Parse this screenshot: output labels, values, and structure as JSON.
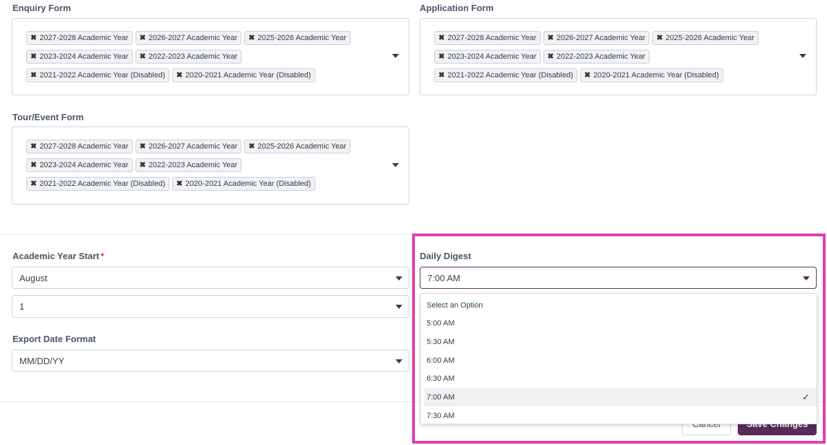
{
  "enquiry_form": {
    "label": "Enquiry Form",
    "tags": [
      "2027-2028 Academic Year",
      "2026-2027 Academic Year",
      "2025-2026 Academic Year",
      "2023-2024 Academic Year",
      "2022-2023 Academic Year",
      "2021-2022 Academic Year (Disabled)",
      "2020-2021 Academic Year (Disabled)"
    ]
  },
  "application_form": {
    "label": "Application Form",
    "tags": [
      "2027-2028 Academic Year",
      "2026-2027 Academic Year",
      "2025-2026 Academic Year",
      "2023-2024 Academic Year",
      "2022-2023 Academic Year",
      "2021-2022 Academic Year (Disabled)",
      "2020-2021 Academic Year (Disabled)"
    ]
  },
  "tour_event_form": {
    "label": "Tour/Event Form",
    "tags": [
      "2027-2028 Academic Year",
      "2026-2027 Academic Year",
      "2025-2026 Academic Year",
      "2023-2024 Academic Year",
      "2022-2023 Academic Year",
      "2021-2022 Academic Year (Disabled)",
      "2020-2021 Academic Year (Disabled)"
    ]
  },
  "tag_remove_glyph": "✖",
  "academic_year_start": {
    "label": "Academic Year Start",
    "required_mark": "*",
    "month_value": "August",
    "day_value": "1"
  },
  "export_date_format": {
    "label": "Export Date Format",
    "value": "MM/DD/YY"
  },
  "daily_digest": {
    "label": "Daily Digest",
    "value": "7:00 AM",
    "options": [
      "Select an Option",
      "5:00 AM",
      "5:30 AM",
      "6:00 AM",
      "6:30 AM",
      "7:00 AM",
      "7:30 AM"
    ],
    "selected_index": 5,
    "check_glyph": "✓"
  },
  "footer": {
    "cancel_label": "Cancel",
    "save_label": "Save Changes"
  },
  "colors": {
    "accent": "#5a2a5a",
    "highlight": "#e43ab3",
    "required": "#d23c3c"
  }
}
